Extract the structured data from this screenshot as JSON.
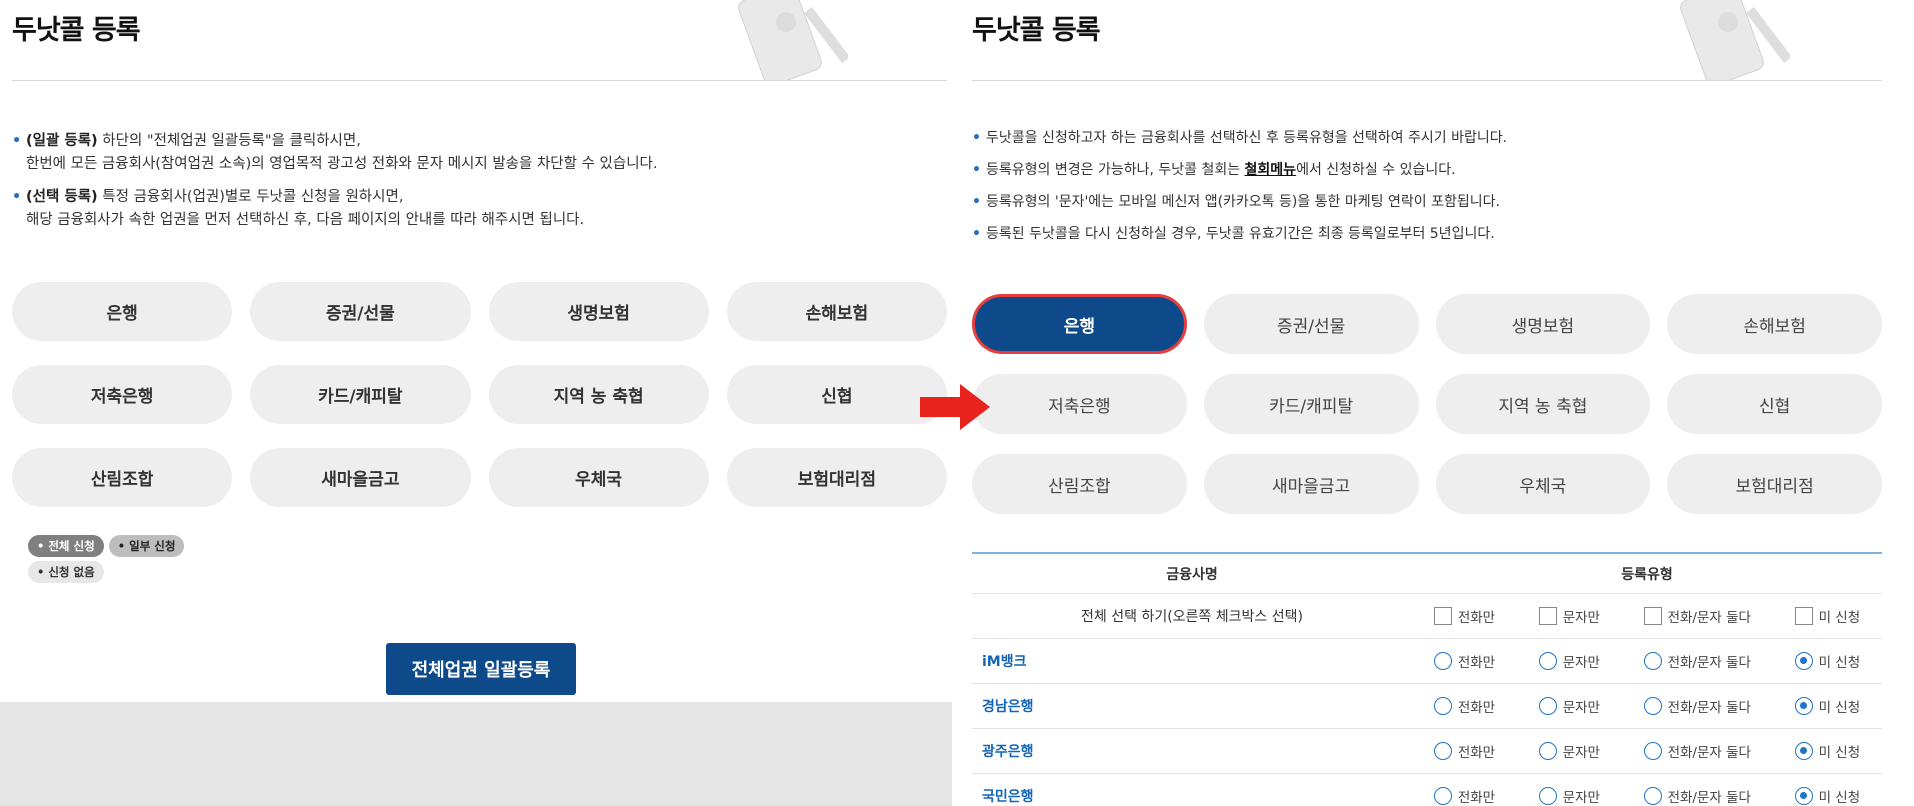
{
  "left": {
    "title": "두낫콜 등록",
    "bullets": [
      {
        "bold": "(일괄 등록)",
        "text": " 하단의 \"전체업권 일괄등록\"을 클릭하시면,",
        "sub": "한번에 모든 금융회사(참여업권 소속)의 영업목적 광고성 전화와 문자 메시지 발송을 차단할 수 있습니다."
      },
      {
        "bold": "(선택 등록)",
        "text": " 특정 금융회사(업권)별로 두낫콜 신청을 원하시면,",
        "sub": "해당 금융회사가 속한 업권을 먼저 선택하신 후, 다음 페이지의 안내를 따라 해주시면 됩니다."
      }
    ],
    "categories": [
      "은행",
      "증권/선물",
      "생명보험",
      "손해보험",
      "저축은행",
      "카드/캐피탈",
      "지역 농 축협",
      "신협",
      "산림조합",
      "새마을금고",
      "우체국",
      "보험대리점"
    ],
    "legend": {
      "all": "• 전체 신청",
      "partial": "• 일부 신청",
      "none": "• 신청 없음"
    },
    "bulk_button": "전체업권 일괄등록"
  },
  "right": {
    "title": "두낫콜 등록",
    "bullets": [
      {
        "pre": "두낫콜을 신청하고자 하는 금융회사를 선택하신 후 등록유형을 선택하여 주시기 바랍니다."
      },
      {
        "pre": "등록유형의 변경은 가능하나, 두낫콜 철회는 ",
        "link": "철회메뉴",
        "post": "에서 신청하실 수 있습니다."
      },
      {
        "pre": "등록유형의 '문자'에는 모바일 메신저 앱(카카오톡 등)을 통한 마케팅 연락이 포함됩니다."
      },
      {
        "pre": "등록된 두낫콜을 다시 신청하실 경우, 두낫콜 유효기간은 최종 등록일로부터 5년입니다."
      }
    ],
    "categories": [
      "은행",
      "증권/선물",
      "생명보험",
      "손해보험",
      "저축은행",
      "카드/캐피탈",
      "지역 농 축협",
      "신협",
      "산림조합",
      "새마을금고",
      "우체국",
      "보험대리점"
    ],
    "active_category": "은행",
    "table": {
      "headers": {
        "name": "금융사명",
        "type": "등록유형"
      },
      "select_all_label": "전체 선택 하기(오른쪽 체크박스 선택)",
      "options": [
        "전화만",
        "문자만",
        "전화/문자 둘다",
        "미 신청"
      ],
      "rows": [
        {
          "name": "iM뱅크",
          "selected": "미 신청"
        },
        {
          "name": "경남은행",
          "selected": "미 신청"
        },
        {
          "name": "광주은행",
          "selected": "미 신청"
        },
        {
          "name": "국민은행",
          "selected": "미 신청"
        }
      ]
    }
  },
  "colors": {
    "primary": "#0e4a8a",
    "highlight_border": "#e63e3e",
    "arrow": "#e8231d",
    "bank_link": "#1565b5",
    "radio": "#1f74c8"
  }
}
